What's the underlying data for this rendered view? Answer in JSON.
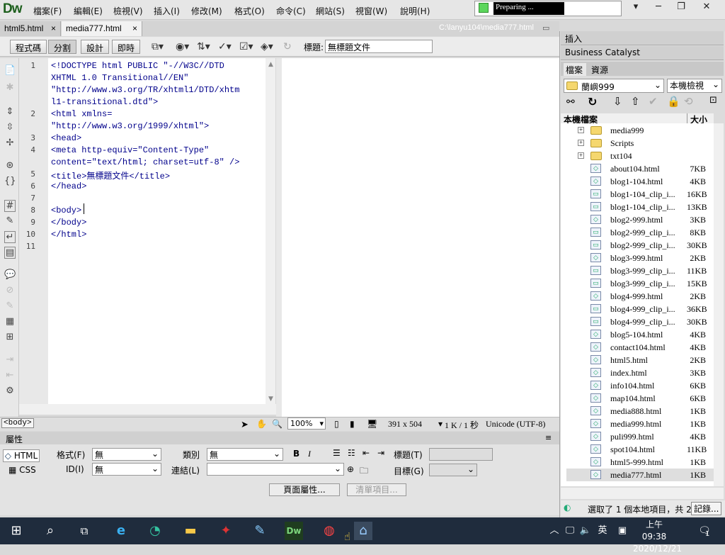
{
  "app": {
    "logo": "Dw",
    "progress_text": "Preparing ...",
    "menu": [
      "檔案(F)",
      "編輯(E)",
      "檢視(V)",
      "插入(I)",
      "修改(M)",
      "格式(O)",
      "命令(C)",
      "網站(S)",
      "視窗(W)",
      "說明(H)"
    ]
  },
  "tabs": [
    {
      "label": "html5.html"
    },
    {
      "label": "media777.html"
    }
  ],
  "tab_close": "×",
  "file_path": "C:\\lanyu104\\media777.html",
  "toolbar": {
    "code": "程式碼",
    "split": "分割",
    "design": "設計",
    "live": "即時",
    "title_label": "標題:",
    "title_value": "無標題文件"
  },
  "code_lines": [
    {
      "n": "1",
      "text": "<!DOCTYPE html PUBLIC \"-//W3C//DTD"
    },
    {
      "n": "",
      "text": "XHTML 1.0 Transitional//EN\""
    },
    {
      "n": "",
      "text": "\"http://www.w3.org/TR/xhtml1/DTD/xhtm"
    },
    {
      "n": "",
      "text": "l1-transitional.dtd\">"
    },
    {
      "n": "2",
      "text": "<html xmlns="
    },
    {
      "n": "",
      "text": "\"http://www.w3.org/1999/xhtml\">"
    },
    {
      "n": "3",
      "text": "<head>"
    },
    {
      "n": "4",
      "text": "<meta http-equiv=\"Content-Type\""
    },
    {
      "n": "",
      "text": "content=\"text/html; charset=utf-8\" />"
    },
    {
      "n": "5",
      "text": "<title>無標題文件</title>"
    },
    {
      "n": "6",
      "text": "</head>"
    },
    {
      "n": "7",
      "text": ""
    },
    {
      "n": "8",
      "text": "<body>"
    },
    {
      "n": "9",
      "text": "</body>"
    },
    {
      "n": "10",
      "text": "</html>"
    },
    {
      "n": "11",
      "text": ""
    }
  ],
  "status": {
    "tag": "<body>",
    "zoom": "100%",
    "dims": "391 x 504",
    "size": "1 K / 1 秒",
    "encoding": "Unicode (UTF-8)"
  },
  "properties": {
    "header": "屬性",
    "html_btn": "HTML",
    "css_btn": "CSS",
    "format_label": "格式(F)",
    "format_value": "無",
    "id_label": "ID(I)",
    "id_value": "無",
    "class_label": "類別",
    "class_value": "無",
    "link_label": "連結(L)",
    "title_label": "標題(T)",
    "target_label": "目標(G)",
    "page_props_btn": "頁面屬性...",
    "list_item_btn": "清單項目..."
  },
  "panels": {
    "insert": "插入",
    "bc": "Business Catalyst",
    "files_tab": "檔案",
    "assets_tab": "資源",
    "site": "蘭嶼999",
    "view": "本機檢視",
    "col_name": "本機檔案",
    "col_size": "大小",
    "status_text": "選取了 1 個本地項目，共 2",
    "log_btn": "記錄..."
  },
  "files": [
    {
      "name": "media999",
      "size": "",
      "type": "folder"
    },
    {
      "name": "Scripts",
      "size": "",
      "type": "folder"
    },
    {
      "name": "txt104",
      "size": "",
      "type": "folder"
    },
    {
      "name": "about104.html",
      "size": "7KB",
      "type": "html"
    },
    {
      "name": "blog1-104.html",
      "size": "4KB",
      "type": "html"
    },
    {
      "name": "blog1-104_clip_i...",
      "size": "16KB",
      "type": "img"
    },
    {
      "name": "blog1-104_clip_i...",
      "size": "13KB",
      "type": "img"
    },
    {
      "name": "blog2-999.html",
      "size": "3KB",
      "type": "html"
    },
    {
      "name": "blog2-999_clip_i...",
      "size": "8KB",
      "type": "img"
    },
    {
      "name": "blog2-999_clip_i...",
      "size": "30KB",
      "type": "img"
    },
    {
      "name": "blog3-999.html",
      "size": "2KB",
      "type": "html"
    },
    {
      "name": "blog3-999_clip_i...",
      "size": "11KB",
      "type": "img"
    },
    {
      "name": "blog3-999_clip_i...",
      "size": "15KB",
      "type": "img"
    },
    {
      "name": "blog4-999.html",
      "size": "2KB",
      "type": "html"
    },
    {
      "name": "blog4-999_clip_i...",
      "size": "36KB",
      "type": "img"
    },
    {
      "name": "blog4-999_clip_i...",
      "size": "30KB",
      "type": "img"
    },
    {
      "name": "blog5-104.html",
      "size": "4KB",
      "type": "html"
    },
    {
      "name": "contact104.html",
      "size": "4KB",
      "type": "html"
    },
    {
      "name": "html5.html",
      "size": "2KB",
      "type": "html"
    },
    {
      "name": "index.html",
      "size": "3KB",
      "type": "html"
    },
    {
      "name": "info104.html",
      "size": "6KB",
      "type": "html"
    },
    {
      "name": "map104.html",
      "size": "6KB",
      "type": "html"
    },
    {
      "name": "media888.html",
      "size": "1KB",
      "type": "html"
    },
    {
      "name": "media999.html",
      "size": "1KB",
      "type": "html"
    },
    {
      "name": "puli999.html",
      "size": "4KB",
      "type": "html"
    },
    {
      "name": "spot104.html",
      "size": "11KB",
      "type": "html"
    },
    {
      "name": "html5-999.html",
      "size": "1KB",
      "type": "html"
    },
    {
      "name": "media777.html",
      "size": "1KB",
      "type": "html"
    }
  ],
  "taskbar": {
    "ime": "英",
    "time": "上午 09:38",
    "date": "2020/12/21",
    "notif": "1"
  }
}
